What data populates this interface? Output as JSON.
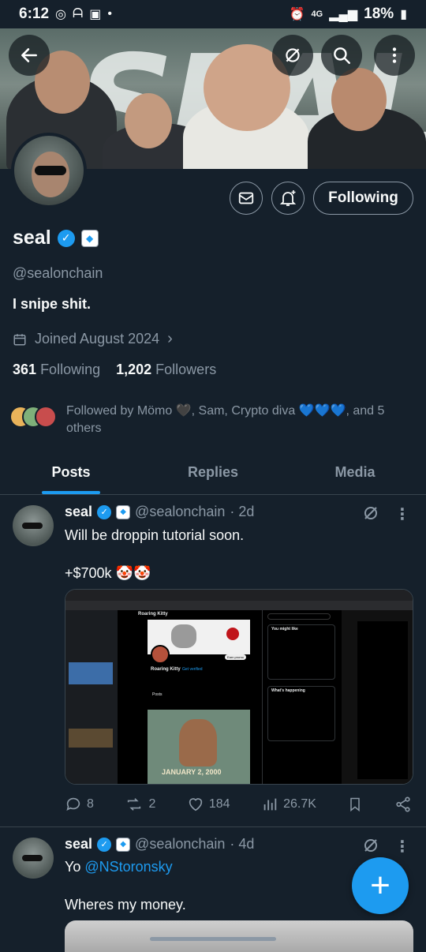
{
  "status_bar": {
    "time": "6:12",
    "network": "4G",
    "battery": "18%"
  },
  "profile": {
    "name": "seal",
    "handle": "@sealonchain",
    "bio": "I snipe shit.",
    "joined": "Joined August 2024",
    "following_count": "361",
    "following_label": "Following",
    "followers_count": "1,202",
    "followers_label": "Followers",
    "followed_by": "Followed by Mömo 🖤, Sam, Crypto diva 💙💙💙, and 5 others",
    "follow_button_label": "Following",
    "banner_text": "SEAL"
  },
  "tabs": [
    {
      "label": "Posts",
      "active": true
    },
    {
      "label": "Replies",
      "active": false
    },
    {
      "label": "Media",
      "active": false
    }
  ],
  "posts": [
    {
      "name": "seal",
      "handle": "@sealonchain",
      "time": "· 2d",
      "line1": "Will be droppin tutorial soon.",
      "line2": "+$700k 🤡🤡",
      "replies": "8",
      "reposts": "2",
      "likes": "184",
      "views": "26.7K",
      "media_embedded_text": {
        "profile_name": "Roaring Kitty",
        "tab_posts": "Posts",
        "caption": "JANUARY 2, 2000",
        "you_might_like": "You might like",
        "whats_happening": "What's happening",
        "earn_promo": "Get verified",
        "verify_sub": "Earn promo"
      }
    },
    {
      "name": "seal",
      "handle": "@sealonchain",
      "time": "· 4d",
      "line1_prefix": "Yo ",
      "line1_mention": "@NStoronsky",
      "line2": "Wheres my money."
    }
  ],
  "colors": {
    "background": "#15202b",
    "accent": "#1d9bf0",
    "secondary_text": "#8b98a5",
    "divider": "#38444d"
  }
}
